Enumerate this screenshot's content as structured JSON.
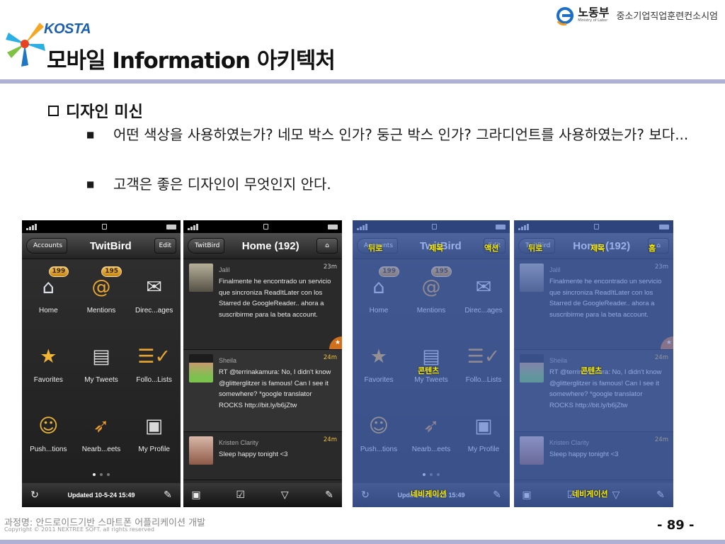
{
  "header": {
    "org": "KOSTA",
    "title": "모바일 Information 아키텍처",
    "ministry": {
      "name": "노동부",
      "name_en": "Ministry of Labor",
      "program": "중소기업직업훈련컨소시엄"
    }
  },
  "content": {
    "heading": "디자인 미신",
    "bullets": [
      "어떤 색상을 사용하였는가? 네모 박스 인가? 둥근 박스 인가? 그라디언트를 사용하였는가? 보다...",
      "고객은 좋은 디자인이 무엇인지 안다."
    ]
  },
  "phones": {
    "menu": {
      "back": "Accounts",
      "title": "TwitBird",
      "edit": "Edit",
      "items": [
        {
          "label": "Home",
          "icon": "home-icon",
          "badge": "199"
        },
        {
          "label": "Mentions",
          "icon": "at-icon",
          "badge": "195"
        },
        {
          "label": "Direc...ages",
          "icon": "envelope-icon"
        },
        {
          "label": "Favorites",
          "icon": "star-icon"
        },
        {
          "label": "My Tweets",
          "icon": "tweet-bubble-icon"
        },
        {
          "label": "Follo...Lists",
          "icon": "list-check-icon"
        },
        {
          "label": "Push...tions",
          "icon": "smiley-icon"
        },
        {
          "label": "Nearb...eets",
          "icon": "compass-icon"
        },
        {
          "label": "My Profile",
          "icon": "id-card-icon"
        }
      ],
      "updated": "Updated 10-5-24 15:49"
    },
    "feed": {
      "back": "TwitBird",
      "title": "Home (192)",
      "tweets": [
        {
          "user": "Jalil",
          "time": "23m",
          "text": "Finalmente he encontrado un servicio que sincroniza ReadItLater con los Starred de GoogleReader.. ahora a suscribirme para la beta account."
        },
        {
          "user": "Sheila",
          "time": "24m",
          "text": "RT @terrinakamura: No, I didn't know @glitterglitzer is famous! Can I see it somewhere? *google translator ROCKS http://bit.ly/b6jZtw"
        },
        {
          "user": "Kristen Clarity",
          "time": "24m",
          "text": "Sleep happy tonight <3"
        }
      ]
    },
    "annotations": {
      "back": "뒤로",
      "title": "제목",
      "action": "액션",
      "home": "홈",
      "content": "콘텐츠",
      "navigation": "네비게이션"
    }
  },
  "footer": {
    "course": "과정명: 안드로이드기반 스마트폰 어플리케이션 개발",
    "copyright": "Copyright © 2011 NEXTREE SOFT. all rights reserved",
    "page": "- 89 -"
  },
  "colors": {
    "accent_rule": "#aeb0d4",
    "overlay_blue": "#5076d7",
    "annotation": "#fff200",
    "badge": "#e0a532"
  }
}
